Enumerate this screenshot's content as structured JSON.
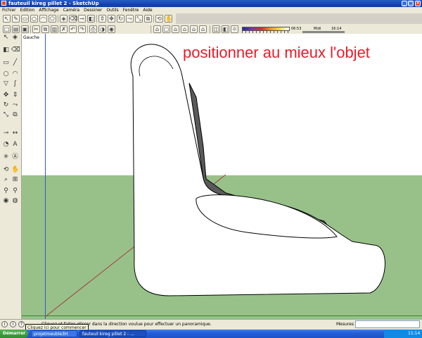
{
  "window": {
    "title": "fauteuil kireg pillet 2 - SketchUp"
  },
  "menu": [
    "Fichier",
    "Edition",
    "Affichage",
    "Caméra",
    "Dessiner",
    "Outils",
    "Fenêtre",
    "Aide"
  ],
  "shadow_settings": {
    "time_left": "06:53",
    "midi": "Midi",
    "time_right": "16:14"
  },
  "viewport": {
    "view_label": "Gauche",
    "overlay_text": "positionner au mieux l'objet"
  },
  "status": {
    "message": "Cliquez et faites glisser dans la direction voulue pour effectuer un panoramique.",
    "tooltip": "Cliquez ici pour commencer",
    "measures_label": "Mesures",
    "measures_value": ""
  },
  "taskbar": {
    "start_label": "Démarrer",
    "tasks": [
      "projetmeuble3H",
      "fauteuil kireg pillet 2 - ..."
    ],
    "clock": "11:14"
  },
  "colors": {
    "title_bar": "#1542b5",
    "overlay_text": "#e81c2a",
    "ground": "#98c18a",
    "sky": "#ffffff"
  }
}
